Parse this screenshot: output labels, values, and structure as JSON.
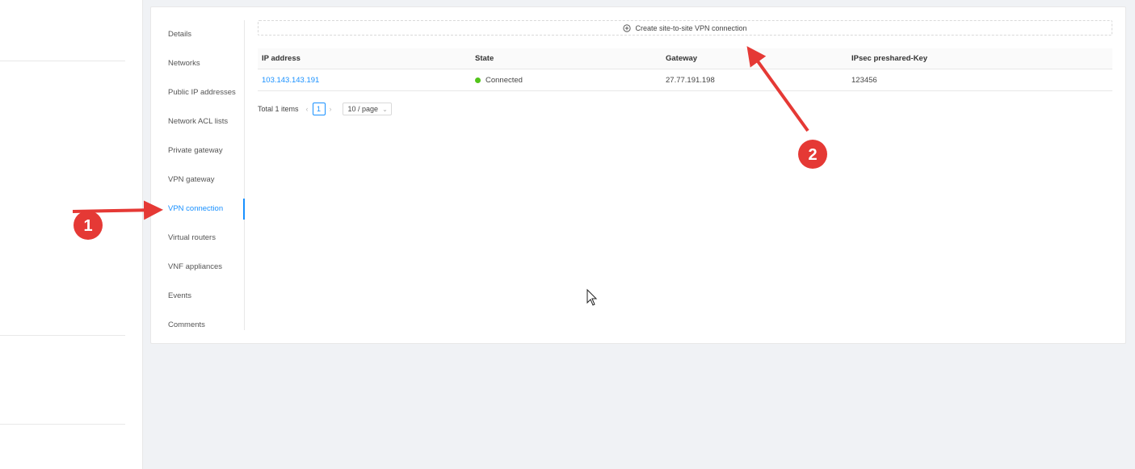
{
  "tabs": [
    {
      "label": "Details"
    },
    {
      "label": "Networks"
    },
    {
      "label": "Public IP addresses"
    },
    {
      "label": "Network ACL lists"
    },
    {
      "label": "Private gateway"
    },
    {
      "label": "VPN gateway"
    },
    {
      "label": "VPN connection",
      "active": true
    },
    {
      "label": "Virtual routers"
    },
    {
      "label": "VNF appliances"
    },
    {
      "label": "Events"
    },
    {
      "label": "Comments"
    }
  ],
  "toolbar": {
    "create_label": "Create site-to-site VPN connection",
    "create_icon": "plus-circle-icon"
  },
  "table": {
    "columns": [
      "IP address",
      "State",
      "Gateway",
      "IPsec preshared-Key"
    ],
    "rows": [
      {
        "ip": "103.143.143.191",
        "state": "Connected",
        "gateway": "27.77.191.198",
        "psk": "123456"
      }
    ]
  },
  "pagination": {
    "total": "Total 1 items",
    "current_page": "1",
    "page_size": "10 / page"
  },
  "annotations": {
    "badge_1": "1",
    "badge_2": "2",
    "arrow_color": "#e53935"
  },
  "colors": {
    "accent": "#1890ff",
    "status_ok": "#52c41a"
  }
}
